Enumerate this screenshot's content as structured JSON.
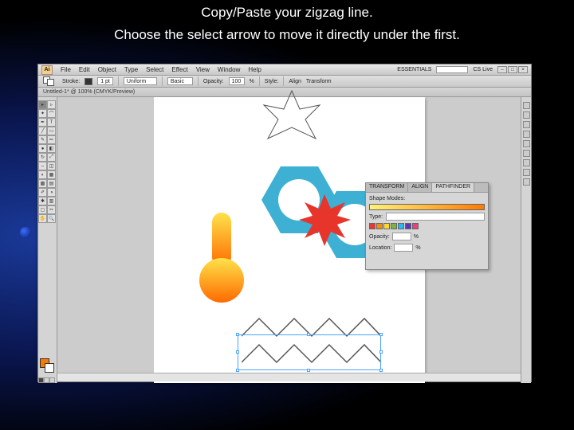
{
  "instructions": {
    "line1": "Copy/Paste your zigzag line.",
    "line2": "Choose the select arrow to move it directly under the first."
  },
  "app": {
    "logo": "Ai",
    "menu": [
      "File",
      "Edit",
      "Object",
      "Type",
      "Select",
      "Effect",
      "View",
      "Window",
      "Help"
    ],
    "workspace": "ESSENTIALS",
    "cs_label": "CS Live",
    "document_tab": "Untitled-1* @ 100% (CMYK/Preview)"
  },
  "optionbar": {
    "stroke_label": "Stroke:",
    "stroke_val": "1 pt",
    "brush_val": "Uniform",
    "style_val": "Basic",
    "opacity_label": "Opacity:",
    "opacity_val": "100",
    "opacity_unit": "%",
    "style_label": "Style:",
    "align_label": "Align",
    "transform_label": "Transform"
  },
  "panel": {
    "tabs": [
      "TRANSFORM",
      "ALIGN",
      "PATHFINDER"
    ],
    "shape_modes": "Shape Modes:",
    "type_label": "Type:",
    "type_val": "",
    "opacity_label": "Opacity:",
    "opacity_val": "",
    "location_label": "Location:",
    "location_val": "",
    "percent": "%"
  },
  "swatches": [
    "#e53935",
    "#fb8c00",
    "#fdd835",
    "#7cb342",
    "#29b6f6",
    "#5e35b1",
    "#ec407a"
  ]
}
